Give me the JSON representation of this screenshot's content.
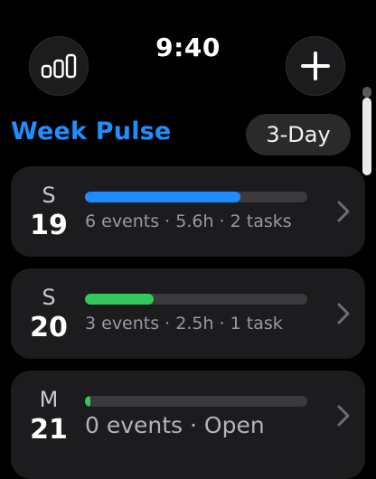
{
  "status": {
    "time": "9:40",
    "left_button_icon": "bar-chart-icon",
    "right_button_icon": "plus-icon"
  },
  "header": {
    "title": "Week Pulse",
    "range_label": "3-Day"
  },
  "colors": {
    "accent": "#1f8fff",
    "blue_bar": "#1e8cff",
    "green_bar": "#34c759"
  },
  "days": [
    {
      "letter": "S",
      "number": "19",
      "summary": "6 events · 5.6h · 2 tasks",
      "fill_fraction": 0.7,
      "bar_color": "#1e8cff"
    },
    {
      "letter": "S",
      "number": "20",
      "summary": "3 events · 2.5h · 1 task",
      "fill_fraction": 0.31,
      "bar_color": "#34c759"
    },
    {
      "letter": "M",
      "number": "21",
      "summary": "0 events · Open",
      "fill_fraction": 0.025,
      "bar_color": "#34c759"
    }
  ]
}
